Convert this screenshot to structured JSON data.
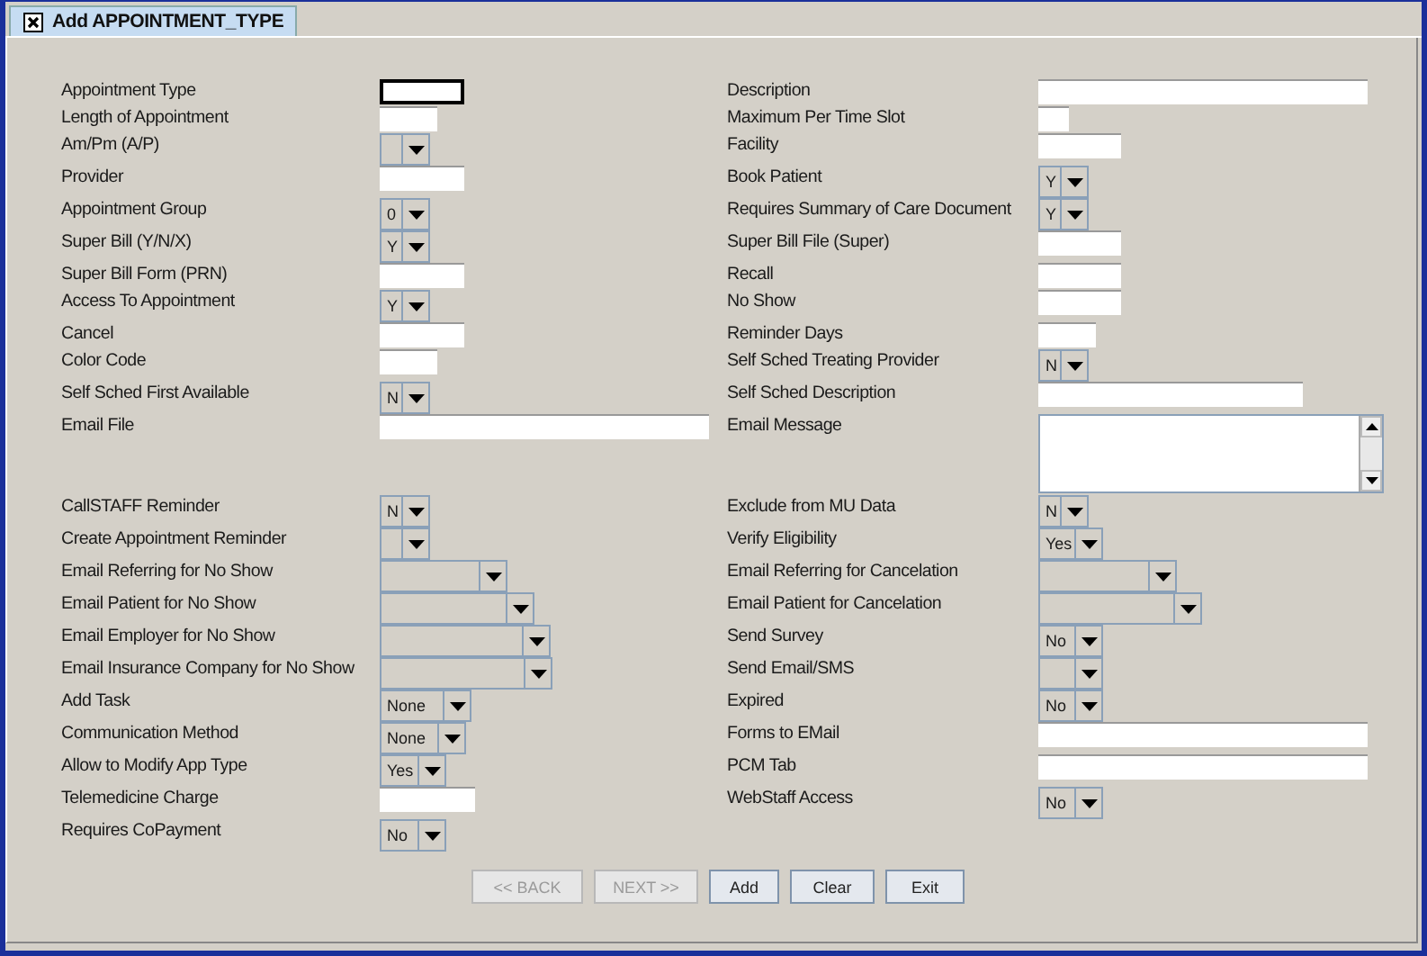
{
  "window": {
    "title": "Add APPOINTMENT_TYPE"
  },
  "rows": [
    {
      "left": {
        "label": "Appointment Type",
        "kind": "text",
        "focused": true
      },
      "right": {
        "label": "Description",
        "kind": "text"
      }
    },
    {
      "left": {
        "label": "Length of Appointment",
        "kind": "text"
      },
      "right": {
        "label": "Maximum Per Time Slot",
        "kind": "text"
      }
    },
    {
      "left": {
        "label": "Am/Pm (A/P)",
        "kind": "combo"
      },
      "right": {
        "label": "Facility",
        "kind": "text"
      }
    },
    {
      "left": {
        "label": "Provider",
        "kind": "text"
      },
      "right": {
        "label": "Book Patient",
        "kind": "combo",
        "value": "Y"
      }
    },
    {
      "left": {
        "label": "Appointment Group",
        "kind": "combo",
        "value": "0"
      },
      "right": {
        "label": "Requires Summary of Care Document",
        "kind": "combo",
        "value": "Y"
      }
    },
    {
      "left": {
        "label": "Super Bill (Y/N/X)",
        "kind": "combo",
        "value": "Y"
      },
      "right": {
        "label": "Super Bill File (Super)",
        "kind": "text"
      }
    },
    {
      "left": {
        "label": "Super Bill Form (PRN)",
        "kind": "text"
      },
      "right": {
        "label": "Recall",
        "kind": "text"
      }
    },
    {
      "left": {
        "label": "Access To Appointment",
        "kind": "combo",
        "value": "Y"
      },
      "right": {
        "label": "No Show",
        "kind": "text"
      }
    },
    {
      "left": {
        "label": "Cancel",
        "kind": "text"
      },
      "right": {
        "label": "Reminder Days",
        "kind": "text"
      }
    },
    {
      "left": {
        "label": "Color Code",
        "kind": "text"
      },
      "right": {
        "label": "Self Sched Treating Provider",
        "kind": "combo",
        "value": "N"
      }
    },
    {
      "left": {
        "label": "Self Sched First Available",
        "kind": "combo",
        "value": "N"
      },
      "right": {
        "label": "Self Sched Description",
        "kind": "text"
      }
    },
    {
      "left": {
        "label": "Email File",
        "kind": "text"
      },
      "right": {
        "label": "Email Message",
        "kind": "textarea"
      }
    },
    {
      "left": {
        "label": "CallSTAFF Reminder",
        "kind": "combo",
        "value": "N"
      },
      "right": {
        "label": "Exclude from MU Data",
        "kind": "combo",
        "value": "N"
      }
    },
    {
      "left": {
        "label": "Create Appointment Reminder",
        "kind": "combo"
      },
      "right": {
        "label": "Verify Eligibility",
        "kind": "combo",
        "value": "Yes"
      }
    },
    {
      "left": {
        "label": "Email Referring for No Show",
        "kind": "combo"
      },
      "right": {
        "label": "Email Referring for Cancelation",
        "kind": "combo"
      }
    },
    {
      "left": {
        "label": "Email Patient for No Show",
        "kind": "combo"
      },
      "right": {
        "label": "Email Patient for Cancelation",
        "kind": "combo"
      }
    },
    {
      "left": {
        "label": "Email Employer for No Show",
        "kind": "combo"
      },
      "right": {
        "label": "Send Survey",
        "kind": "combo",
        "value": "No"
      }
    },
    {
      "left": {
        "label": "Email Insurance Company for No Show",
        "kind": "combo"
      },
      "right": {
        "label": "Send Email/SMS",
        "kind": "combo"
      }
    },
    {
      "left": {
        "label": "Add Task",
        "kind": "combo",
        "value": "None"
      },
      "right": {
        "label": "Expired",
        "kind": "combo",
        "value": "No"
      }
    },
    {
      "left": {
        "label": "Communication Method",
        "kind": "combo",
        "value": "None"
      },
      "right": {
        "label": "Forms to EMail",
        "kind": "text"
      }
    },
    {
      "left": {
        "label": "Allow to Modify App Type",
        "kind": "combo",
        "value": "Yes"
      },
      "right": {
        "label": "PCM Tab",
        "kind": "text"
      }
    },
    {
      "left": {
        "label": "Telemedicine Charge",
        "kind": "text"
      },
      "right": {
        "label": "WebStaff Access",
        "kind": "combo",
        "value": "No"
      }
    },
    {
      "left": {
        "label": "Requires CoPayment",
        "kind": "combo",
        "value": "No"
      }
    }
  ],
  "buttons": [
    {
      "label": "<< BACK",
      "disabled": true
    },
    {
      "label": "NEXT >>",
      "disabled": true
    },
    {
      "label": "Add",
      "disabled": false
    },
    {
      "label": "Clear",
      "disabled": false
    },
    {
      "label": "Exit",
      "disabled": false
    }
  ]
}
